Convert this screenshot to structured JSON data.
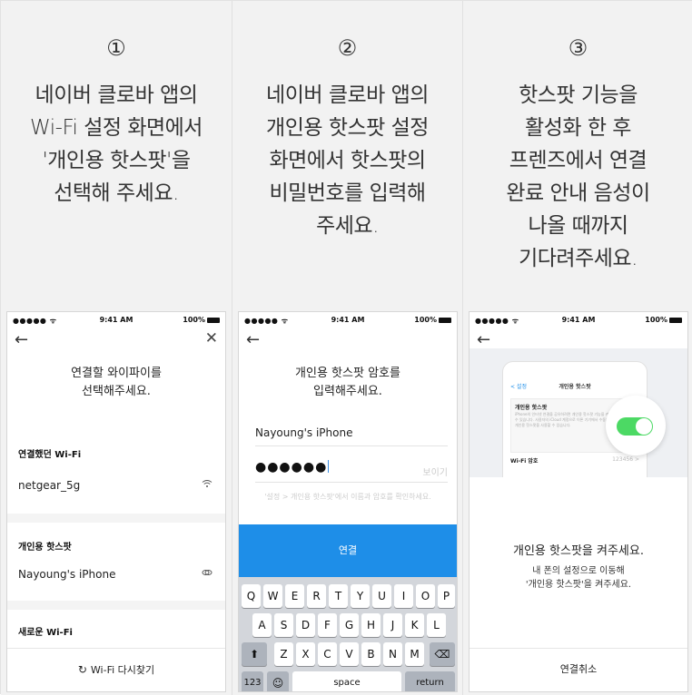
{
  "steps": [
    {
      "number": "①",
      "lines": [
        "네이버 클로바 앱의",
        "Wi-Fi 설정 화면에서",
        "'개인용 핫스팟'을",
        "선택해 주세요."
      ]
    },
    {
      "number": "②",
      "lines": [
        "네이버 클로바 앱의",
        "개인용 핫스팟 설정",
        "화면에서 핫스팟의",
        "비밀번호를 입력해",
        "주세요."
      ]
    },
    {
      "number": "③",
      "lines": [
        "핫스팟 기능을",
        "활성화 한 후",
        "프렌즈에서 연결",
        "완료 안내 음성이",
        "나올 때까지",
        "기다려주세요."
      ]
    }
  ],
  "status_bar": {
    "signal": "●●●●● ᯤ",
    "time": "9:41 AM",
    "battery": "100%"
  },
  "nav": {
    "back": "←",
    "close": "✕"
  },
  "screen1": {
    "title_lines": [
      "연결할 와이파이를",
      "선택해주세요."
    ],
    "section_connected": "연결했던 Wi-Fi",
    "connected_network": "netgear_5g",
    "section_hotspot": "개인용 핫스팟",
    "hotspot_network": "Nayoung's iPhone",
    "section_new": "새로운 Wi-Fi",
    "rescan_label": "Wi-Fi 다시찾기"
  },
  "screen2": {
    "title_lines": [
      "개인용 핫스팟 암호를",
      "입력해주세요."
    ],
    "ssid_value": "Nayoung's iPhone",
    "password_mask": "●●●●●●",
    "show_label": "보이기",
    "hint": "'설정 > 개인용 핫스팟'에서 이름과 암호를 확인하세요.",
    "connect_label": "연결",
    "keyboard": {
      "row1": [
        "Q",
        "W",
        "E",
        "R",
        "T",
        "Y",
        "U",
        "I",
        "O",
        "P"
      ],
      "row2": [
        "A",
        "S",
        "D",
        "F",
        "G",
        "H",
        "J",
        "K",
        "L"
      ],
      "row3": [
        "Z",
        "X",
        "C",
        "V",
        "B",
        "N",
        "M"
      ],
      "shift": "⬆",
      "backspace": "⌫",
      "numbers": "123",
      "emoji": "☺",
      "space": "space",
      "return": "return"
    }
  },
  "screen3": {
    "mock_back": "< 설정",
    "mock_title": "개인용 핫스팟",
    "mock_row_label": "개인용 핫스팟",
    "mock_desc": "iPhone의 인터넷 연결을 공유하려면 개인용 핫스팟 기능을 켜 공급자 무선망 수 있습니다. 사용자의 iCloud 계정으로 이론 기기에서 수동으로 켜지 않아도 개인용 핫스팟을 사용할 수 있습니다.",
    "mock_pw_label": "Wi-Fi 암호",
    "mock_pw_value": "123456 >",
    "toggle_on": true,
    "title": "개인용 핫스팟을 켜주세요.",
    "sub_lines": [
      "내 폰의 설정으로 이동해",
      "'개인용 핫스팟'을 켜주세요."
    ],
    "cancel_label": "연결취소"
  },
  "colors": {
    "accent": "#1e8ee8",
    "toggle": "#4cd964",
    "panel_bg": "#f2f2f2"
  },
  "icons": {
    "wifi": "wifi-icon",
    "link": "link-icon",
    "refresh": "refresh-icon",
    "back": "back-arrow-icon",
    "close": "close-icon"
  }
}
